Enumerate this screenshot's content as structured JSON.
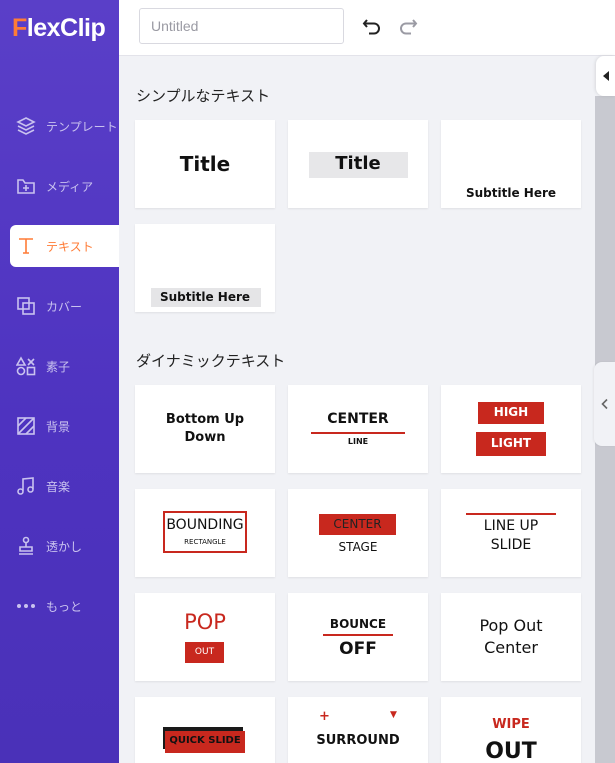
{
  "app": {
    "logo_f": "F",
    "logo_rest": "lexClip"
  },
  "topbar": {
    "title_placeholder": "Untitled",
    "title_value": ""
  },
  "sidebar": {
    "items": [
      {
        "label": "テンプレート",
        "icon": "layers-icon"
      },
      {
        "label": "メディア",
        "icon": "folder-add-icon"
      },
      {
        "label": "テキスト",
        "icon": "text-icon",
        "active": true
      },
      {
        "label": "カバー",
        "icon": "cover-icon"
      },
      {
        "label": "素子",
        "icon": "elements-icon"
      },
      {
        "label": "背景",
        "icon": "background-icon"
      },
      {
        "label": "音楽",
        "icon": "music-icon"
      },
      {
        "label": "透かし",
        "icon": "watermark-icon"
      },
      {
        "label": "もっと",
        "icon": "more-icon"
      }
    ]
  },
  "sections": {
    "simple": {
      "title": "シンプルなテキスト",
      "cards": [
        {
          "l1": "Title"
        },
        {
          "l1": "Title"
        },
        {
          "l1": "Subtitle Here"
        },
        {
          "l1": "Subtitle Here"
        }
      ]
    },
    "dynamic": {
      "title": "ダイナミックテキスト",
      "cards": [
        {
          "l1": "Bottom Up",
          "l2": "Down"
        },
        {
          "l1": "CENTER",
          "l2": "LINE"
        },
        {
          "l1": "HIGH",
          "l2": "LIGHT"
        },
        {
          "l1": "BOUNDING",
          "l2": "RECTANGLE"
        },
        {
          "l1": "CENTER",
          "l2": "STAGE"
        },
        {
          "l1": "LINE UP",
          "l2": "SLIDE"
        },
        {
          "l1": "POP",
          "l2": "OUT"
        },
        {
          "l1": "BOUNCE",
          "l2": "OFF"
        },
        {
          "l1": "Pop Out",
          "l2": "Center"
        },
        {
          "l1": "QUICK SLIDE"
        },
        {
          "l1": "SURROUND"
        },
        {
          "l1": "WIPE",
          "l2": "OUT"
        }
      ]
    }
  },
  "colors": {
    "accent": "#ff7c37",
    "sidebar": "#5a3fc8",
    "red": "#c8281e"
  }
}
